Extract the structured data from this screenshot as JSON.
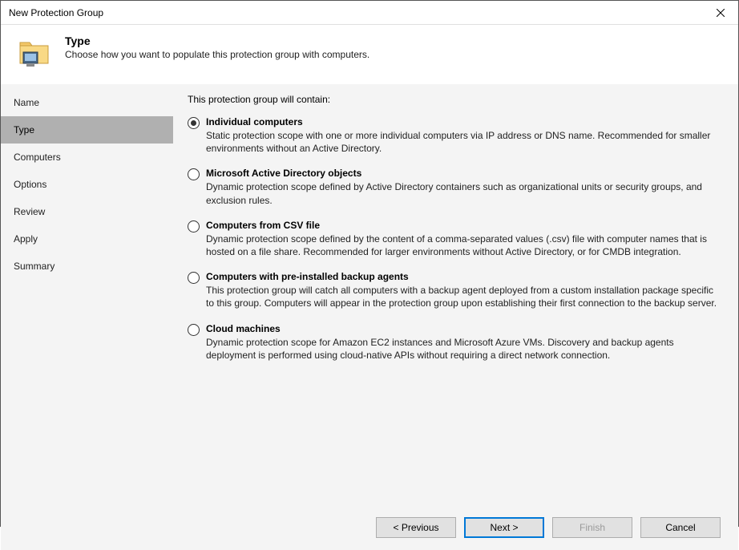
{
  "window": {
    "title": "New Protection Group"
  },
  "header": {
    "title": "Type",
    "subtitle": "Choose how you want to populate this protection group with computers."
  },
  "sidebar": {
    "items": [
      {
        "label": "Name",
        "active": false
      },
      {
        "label": "Type",
        "active": true
      },
      {
        "label": "Computers",
        "active": false
      },
      {
        "label": "Options",
        "active": false
      },
      {
        "label": "Review",
        "active": false
      },
      {
        "label": "Apply",
        "active": false
      },
      {
        "label": "Summary",
        "active": false
      }
    ]
  },
  "content": {
    "intro": "This protection group will contain:",
    "options": [
      {
        "title": "Individual computers",
        "desc": "Static protection scope with one or more individual computers via IP address or DNS name. Recommended for smaller environments without an Active Directory.",
        "selected": true
      },
      {
        "title": "Microsoft Active Directory objects",
        "desc": "Dynamic protection scope defined by Active Directory containers such as organizational units or security groups, and exclusion rules.",
        "selected": false
      },
      {
        "title": "Computers from CSV file",
        "desc": "Dynamic protection scope defined by the content of a comma-separated values (.csv) file with computer names that is hosted on a file share. Recommended for larger environments without Active Directory, or for CMDB integration.",
        "selected": false
      },
      {
        "title": "Computers with pre-installed backup agents",
        "desc": "This protection group will catch all computers with a backup agent deployed from a custom installation package specific to this group.  Computers will appear in the protection group upon establishing their first connection to the backup server.",
        "selected": false
      },
      {
        "title": "Cloud machines",
        "desc": "Dynamic protection scope for Amazon EC2 instances and Microsoft Azure VMs. Discovery and backup agents deployment is performed using cloud-native APIs without requiring a direct network connection.",
        "selected": false
      }
    ]
  },
  "footer": {
    "previous": "< Previous",
    "next": "Next >",
    "finish": "Finish",
    "cancel": "Cancel"
  }
}
